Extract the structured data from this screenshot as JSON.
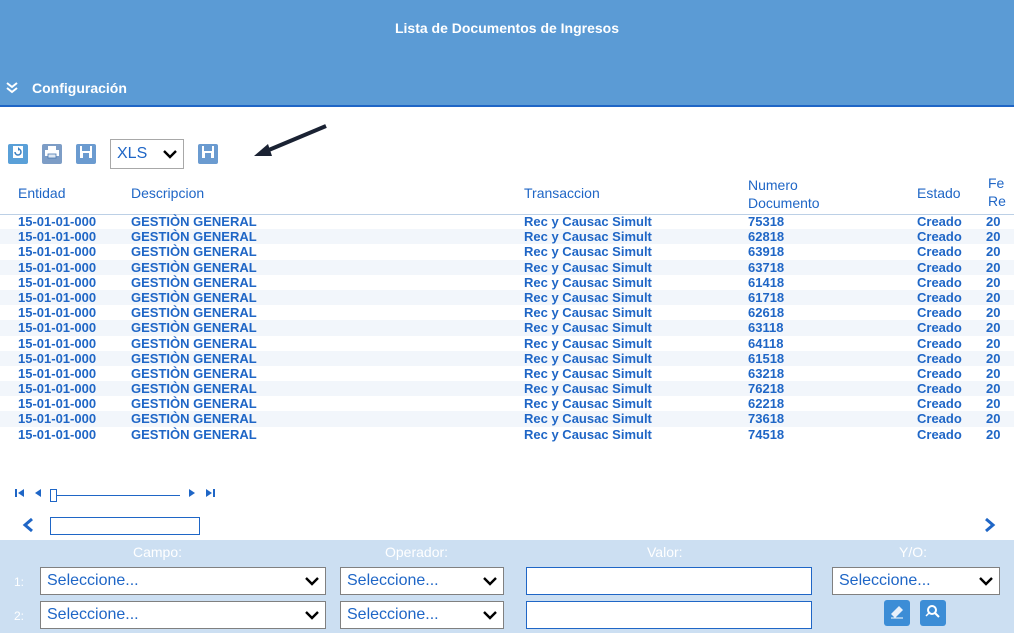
{
  "window": {
    "title": "Lista de Documentos de Ingresos"
  },
  "config": {
    "label": "Configuración"
  },
  "toolbar": {
    "format_select": "XLS",
    "icons": [
      "refresh-icon",
      "print-icon",
      "save-icon",
      "export-save-icon"
    ]
  },
  "grid": {
    "headers": {
      "entidad": "Entidad",
      "descripcion": "Descripcion",
      "transaccion": "Transaccion",
      "numero_line1": "Numero",
      "numero_line2": "Documento",
      "estado": "Estado",
      "fecha_line1": "Fe",
      "fecha_line2": "Re"
    },
    "rows": [
      {
        "entidad": "15-01-01-000",
        "descripcion": "GESTIÒN GENERAL",
        "transaccion": "Rec y Causac Simult",
        "numero": "75318",
        "estado": "Creado",
        "fecha": "20"
      },
      {
        "entidad": "15-01-01-000",
        "descripcion": "GESTIÒN GENERAL",
        "transaccion": "Rec y Causac Simult",
        "numero": "62818",
        "estado": "Creado",
        "fecha": "20"
      },
      {
        "entidad": "15-01-01-000",
        "descripcion": "GESTIÒN GENERAL",
        "transaccion": "Rec y Causac Simult",
        "numero": "63918",
        "estado": "Creado",
        "fecha": "20"
      },
      {
        "entidad": "15-01-01-000",
        "descripcion": "GESTIÒN GENERAL",
        "transaccion": "Rec y Causac Simult",
        "numero": "63718",
        "estado": "Creado",
        "fecha": "20"
      },
      {
        "entidad": "15-01-01-000",
        "descripcion": "GESTIÒN GENERAL",
        "transaccion": "Rec y Causac Simult",
        "numero": "61418",
        "estado": "Creado",
        "fecha": "20"
      },
      {
        "entidad": "15-01-01-000",
        "descripcion": "GESTIÒN GENERAL",
        "transaccion": "Rec y Causac Simult",
        "numero": "61718",
        "estado": "Creado",
        "fecha": "20"
      },
      {
        "entidad": "15-01-01-000",
        "descripcion": "GESTIÒN GENERAL",
        "transaccion": "Rec y Causac Simult",
        "numero": "62618",
        "estado": "Creado",
        "fecha": "20"
      },
      {
        "entidad": "15-01-01-000",
        "descripcion": "GESTIÒN GENERAL",
        "transaccion": "Rec y Causac Simult",
        "numero": "63118",
        "estado": "Creado",
        "fecha": "20"
      },
      {
        "entidad": "15-01-01-000",
        "descripcion": "GESTIÒN GENERAL",
        "transaccion": "Rec y Causac Simult",
        "numero": "64118",
        "estado": "Creado",
        "fecha": "20"
      },
      {
        "entidad": "15-01-01-000",
        "descripcion": "GESTIÒN GENERAL",
        "transaccion": "Rec y Causac Simult",
        "numero": "61518",
        "estado": "Creado",
        "fecha": "20"
      },
      {
        "entidad": "15-01-01-000",
        "descripcion": "GESTIÒN GENERAL",
        "transaccion": "Rec y Causac Simult",
        "numero": "63218",
        "estado": "Creado",
        "fecha": "20"
      },
      {
        "entidad": "15-01-01-000",
        "descripcion": "GESTIÒN GENERAL",
        "transaccion": "Rec y Causac Simult",
        "numero": "76218",
        "estado": "Creado",
        "fecha": "20"
      },
      {
        "entidad": "15-01-01-000",
        "descripcion": "GESTIÒN GENERAL",
        "transaccion": "Rec y Causac Simult",
        "numero": "62218",
        "estado": "Creado",
        "fecha": "20"
      },
      {
        "entidad": "15-01-01-000",
        "descripcion": "GESTIÒN GENERAL",
        "transaccion": "Rec y Causac Simult",
        "numero": "73618",
        "estado": "Creado",
        "fecha": "20"
      },
      {
        "entidad": "15-01-01-000",
        "descripcion": "GESTIÒN GENERAL",
        "transaccion": "Rec y Causac Simult",
        "numero": "74518",
        "estado": "Creado",
        "fecha": "20"
      }
    ]
  },
  "filter": {
    "labels": {
      "campo": "Campo:",
      "operador": "Operador:",
      "valor": "Valor:",
      "yo": "Y/O:"
    },
    "row_numbers": [
      "1:",
      "2:"
    ],
    "row1": {
      "campo": "Seleccione...",
      "operador": "Seleccione...",
      "valor": "",
      "yo": "Seleccione..."
    },
    "row2": {
      "campo": "Seleccione...",
      "operador": "Seleccione...",
      "valor": ""
    }
  },
  "colors": {
    "header_bg": "#5b9bd5",
    "accent": "#1f66c6",
    "filter_bg": "#ccdff2"
  }
}
